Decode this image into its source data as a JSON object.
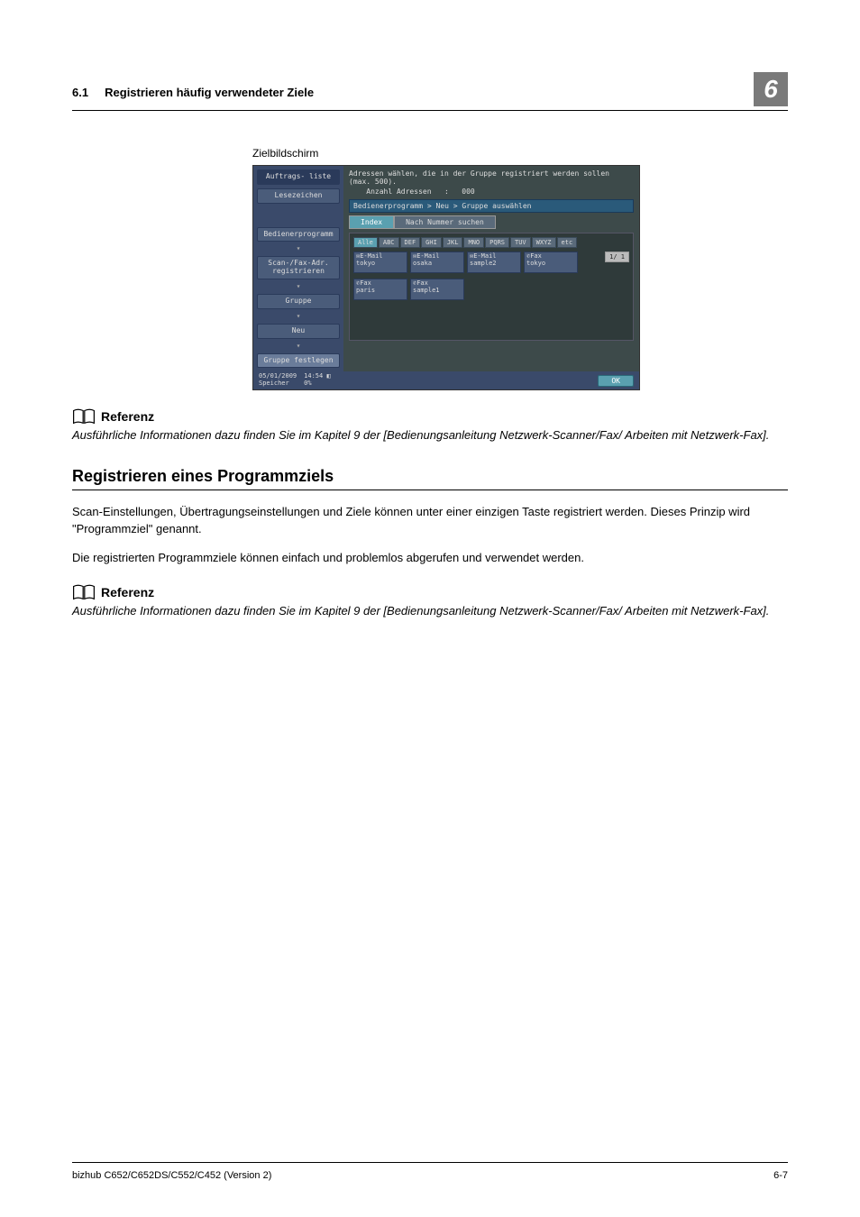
{
  "header": {
    "section_num": "6.1",
    "section_title": "Registrieren häufig verwendeter Ziele",
    "chapter_num": "6"
  },
  "screenshot_caption": "Zielbildschirm",
  "screenshot": {
    "top_msg": "Adressen wählen, die in der Gruppe registriert werden sollen (max. 500).",
    "count_label": "Anzahl Adressen",
    "count_sep": ":",
    "count_val": "000",
    "breadcrumb": "Bedienerprogramm > Neu > Gruppe auswählen",
    "left_buttons": {
      "jobs": "Auftrags-\nliste",
      "bookmark": "Lesezeichen",
      "utility": "Bedienerprogramm",
      "scanfax": "Scan-/Fax-Adr.\nregistrieren",
      "group": "Gruppe",
      "new": "Neu",
      "setgroup": "Gruppe festlegen"
    },
    "tabs": {
      "index": "Index",
      "search": "Nach Nummer suchen"
    },
    "letters": [
      "Alle",
      "ABC",
      "DEF",
      "GHI",
      "JKL",
      "MNO",
      "PQRS",
      "TUV",
      "WXYZ",
      "etc"
    ],
    "destinations": [
      {
        "type": "✉E-Mail",
        "name": "tokyo"
      },
      {
        "type": "✉E-Mail",
        "name": "osaka"
      },
      {
        "type": "✉E-Mail",
        "name": "sample2"
      },
      {
        "type": "✆Fax",
        "name": "tokyo"
      },
      {
        "type": "✆Fax",
        "name": "paris"
      },
      {
        "type": "✆Fax",
        "name": "sample1"
      }
    ],
    "page_ind": "1/ 1",
    "footer_date": "05/01/2009",
    "footer_time": "14:54",
    "footer_mem_label": "Speicher",
    "footer_mem_val": "0%",
    "ok": "OK"
  },
  "ref_label": "Referenz",
  "ref1_text": "Ausführliche Informationen dazu finden Sie im Kapitel 9 der [Bedienungsanleitung Netzwerk-Scanner/Fax/ Arbeiten mit Netzwerk-Fax].",
  "h3": "Registrieren eines Programmziels",
  "para1": "Scan-Einstellungen, Übertragungseinstellungen und Ziele können unter einer einzigen Taste registriert werden. Dieses Prinzip wird \"Programmziel\" genannt.",
  "para2": "Die registrierten Programmziele können einfach und problemlos abgerufen und verwendet werden.",
  "ref2_text": "Ausführliche Informationen dazu finden Sie im Kapitel 9 der [Bedienungsanleitung Netzwerk-Scanner/Fax/ Arbeiten mit Netzwerk-Fax].",
  "footer": {
    "left": "bizhub C652/C652DS/C552/C452 (Version 2)",
    "right": "6-7"
  }
}
